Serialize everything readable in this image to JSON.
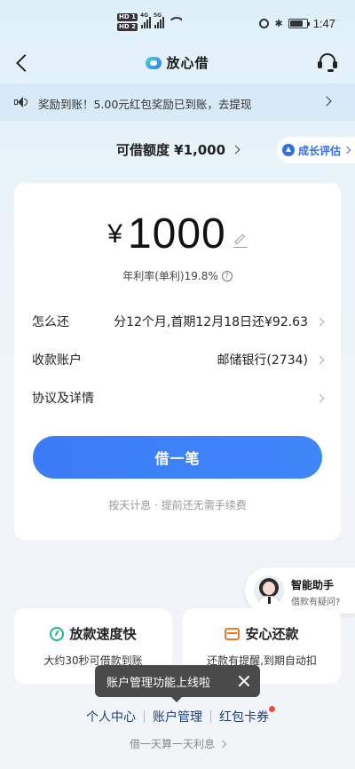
{
  "status_bar": {
    "sim1": "HD 1",
    "sim2": "HD 2",
    "net1": "4G",
    "net2": "5G",
    "time": "1:47"
  },
  "nav": {
    "title": "放心借"
  },
  "notice": {
    "text": "奖励到账！5.00元红包奖励已到账，去提现"
  },
  "credit": {
    "label": "可借额度 ¥1,000",
    "growth_label": "成长评估"
  },
  "loan": {
    "currency": "¥",
    "amount": "1000",
    "rate": "年利率(单利)19.8%",
    "rows": [
      {
        "label": "怎么还",
        "value": "分12个月,首期12月18日还¥92.63"
      },
      {
        "label": "收款账户",
        "value": "邮储银行(2734)"
      },
      {
        "label": "协议及详情",
        "value": ""
      }
    ],
    "button": "借一笔",
    "footnote": "按天计息 · 提前还无需手续费"
  },
  "assistant": {
    "title": "智能助手",
    "subtitle": "借款有疑问?"
  },
  "features": [
    {
      "title": "放款速度快",
      "desc": "大约30秒可借款到账",
      "icon": "speed-icon",
      "color": "#1fb38a"
    },
    {
      "title": "安心还款",
      "desc": "还款有提醒,到期自动扣",
      "icon": "wallet-icon",
      "color": "#f07a2a"
    }
  ],
  "toast": {
    "text": "账户管理功能上线啦"
  },
  "links": [
    "个人中心",
    "账户管理",
    "红包卡券"
  ],
  "slogan": "借一天算一天利息",
  "colors": {
    "primary": "#3b7cf6",
    "accent_red": "#f24c3d"
  }
}
